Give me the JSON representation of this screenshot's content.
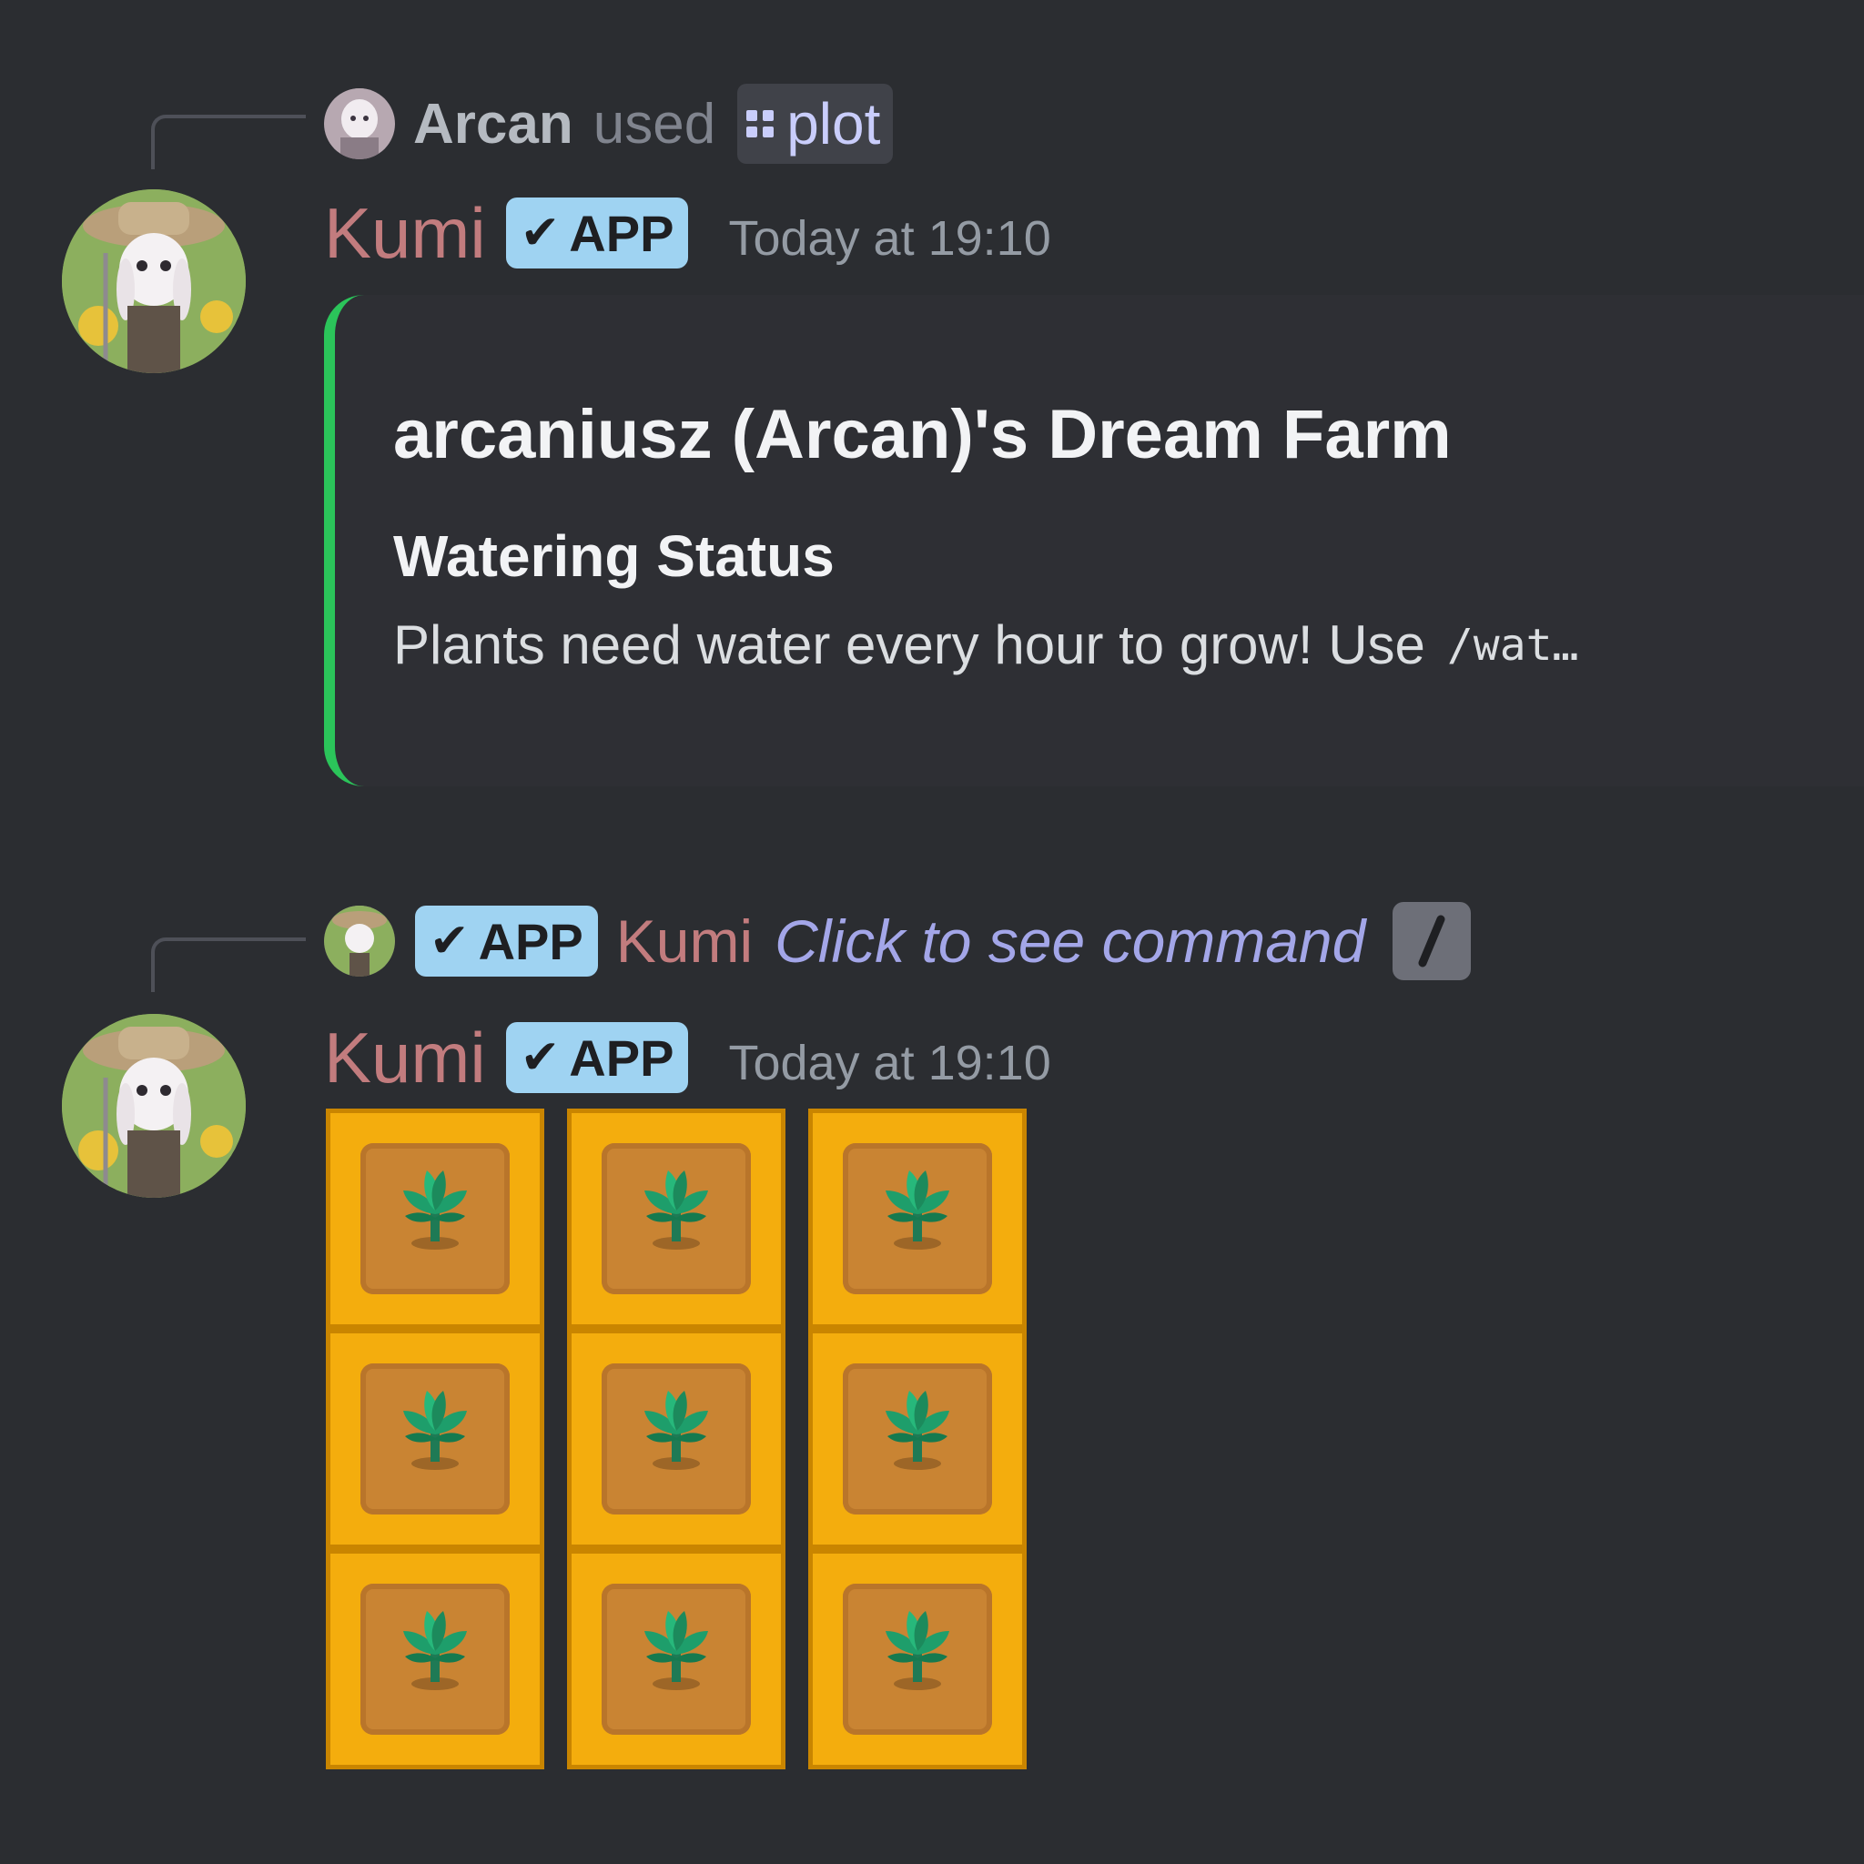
{
  "messages": [
    {
      "reply": {
        "user": "Arcan",
        "verb": "used",
        "command": "plot"
      },
      "author": "Kumi",
      "badge": "APP",
      "timestamp": "Today at 19:10",
      "embed": {
        "accent_color": "#2bc45a",
        "title": "arcaniusz (Arcan)'s Dream Farm",
        "field_name": "Watering Status",
        "field_value": "Plants need water every hour to grow! Use",
        "field_code": "/wat…"
      }
    },
    {
      "reply": {
        "badge": "APP",
        "user": "Kumi",
        "text": "Click to see command"
      },
      "author": "Kumi",
      "badge": "APP",
      "timestamp": "Today at 19:10",
      "plot_grid": {
        "rows": 3,
        "cols": 3,
        "tile_color": "#f4ad0d",
        "soil_color": "#c98433",
        "crop": "sprout-icon"
      }
    }
  ]
}
